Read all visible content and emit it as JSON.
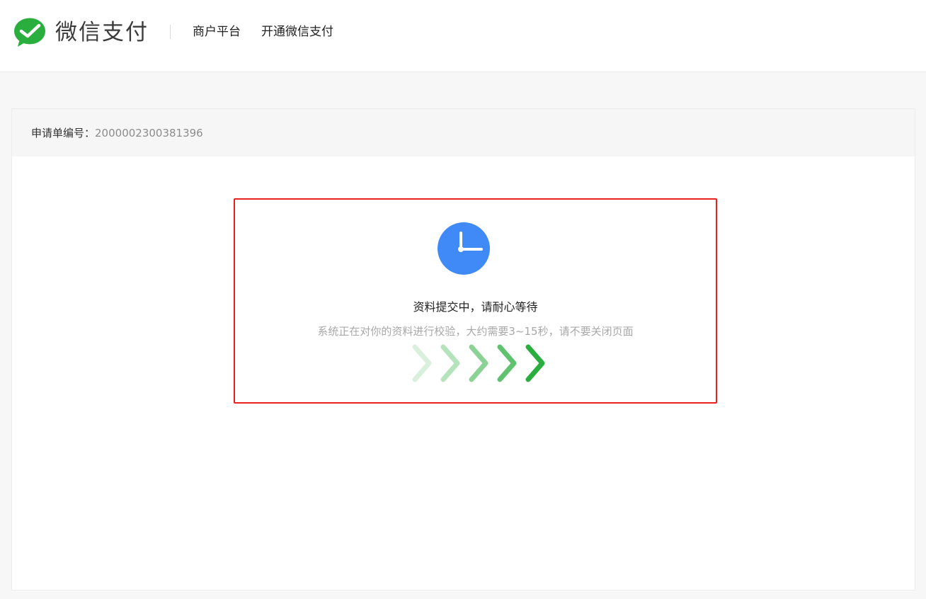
{
  "header": {
    "brand": "微信支付",
    "nav": [
      "商户平台",
      "开通微信支付"
    ]
  },
  "application": {
    "label": "申请单编号：",
    "number": "2000002300381396"
  },
  "status": {
    "title": "资料提交中，请耐心等待",
    "description": "系统正在对你的资料进行校验，大约需要3~15秒，请不要关闭页面",
    "icon": "clock-icon",
    "progress_icon": "chevron-right-icon"
  },
  "colors": {
    "brand_green": "#2aae3e",
    "clock_blue": "#3f8af7",
    "highlight_red": "#e5221f"
  }
}
